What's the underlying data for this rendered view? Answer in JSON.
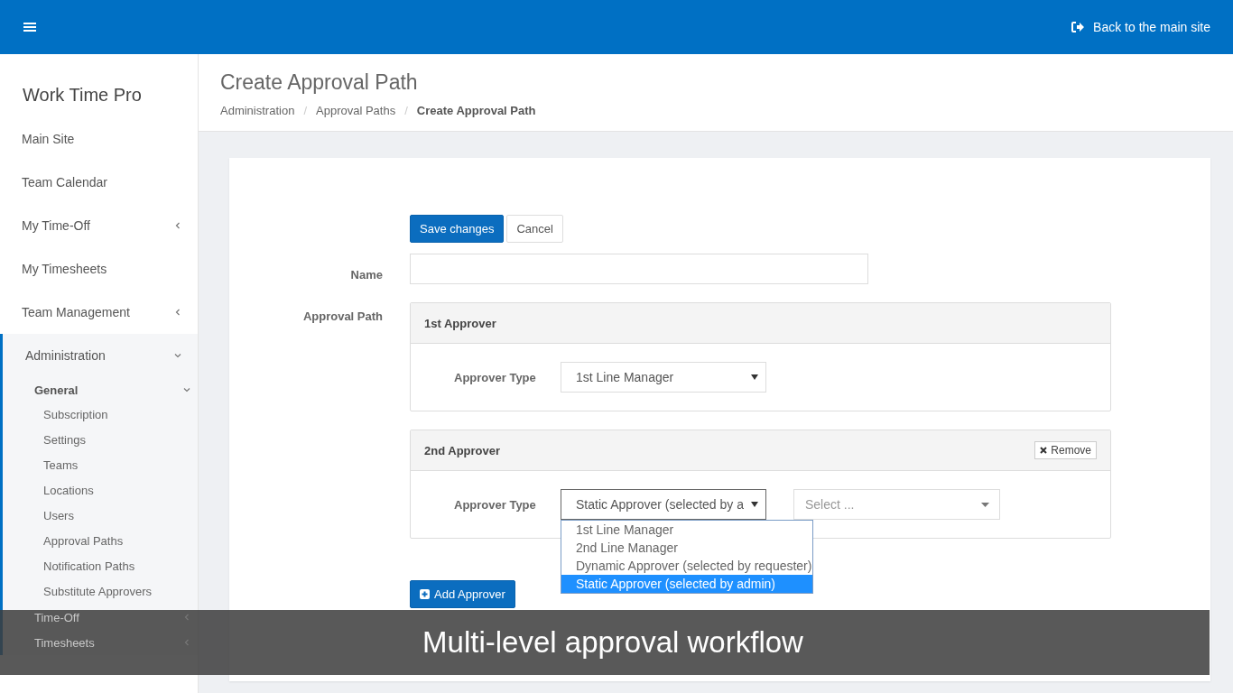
{
  "topbar": {
    "link": "Back to the main site"
  },
  "sidebar": {
    "brand": "Work Time Pro",
    "items": [
      {
        "label": "Main Site",
        "selected": false
      },
      {
        "label": "Team Calendar",
        "selected": false
      },
      {
        "label": "My Time-Off",
        "selected": false,
        "expanded": false
      },
      {
        "label": "My Timesheets",
        "selected": false
      },
      {
        "label": "Team Management",
        "selected": false,
        "expanded": false
      },
      {
        "label": "Administration",
        "selected": true,
        "expanded": true,
        "children": [
          {
            "label": "General",
            "expanded": true,
            "children": [
              {
                "label": "Subscription",
                "selected": false
              },
              {
                "label": "Settings",
                "selected": false
              },
              {
                "label": "Teams",
                "selected": false
              },
              {
                "label": "Locations",
                "selected": false
              },
              {
                "label": "Users",
                "selected": false
              },
              {
                "label": "Approval Paths",
                "selected": false
              },
              {
                "label": "Notification Paths",
                "selected": false
              },
              {
                "label": "Substitute Approvers",
                "selected": false
              }
            ]
          },
          {
            "label": "Time-Off",
            "expanded": false
          },
          {
            "label": "Timesheets",
            "expanded": false
          }
        ]
      }
    ]
  },
  "header": {
    "title": "Create Approval Path",
    "separator": "/",
    "breadcrumb": [
      {
        "label": "Administration",
        "current": false
      },
      {
        "label": "Approval Paths",
        "current": false
      },
      {
        "label": "Create Approval Path",
        "current": true
      }
    ]
  },
  "form": {
    "buttons": [
      {
        "label": "Save changes",
        "kind": "primary"
      },
      {
        "label": "Cancel",
        "kind": "default"
      }
    ],
    "name_label": "Name",
    "path_label": "Approval Path",
    "approvers": [
      {
        "title": "1st Approver",
        "type_label": "Approver Type",
        "value": "1st Line Manager",
        "expanded": false
      },
      {
        "title": "2nd Approver",
        "remove": "Remove",
        "type_label": "Approver Type",
        "value": "Static Approver (selected by a",
        "expanded": true,
        "options": [
          {
            "label": "1st Line Manager",
            "selected": false
          },
          {
            "label": "2nd Line Manager",
            "selected": false
          },
          {
            "label": "Dynamic Approver (selected by requester)",
            "selected": false
          },
          {
            "label": "Static Approver (selected by admin)",
            "selected": true
          }
        ],
        "second_select": {
          "placeholder": "Select ..."
        }
      }
    ],
    "add_button": "Add Approver"
  },
  "caption": "Multi-level approval workflow"
}
